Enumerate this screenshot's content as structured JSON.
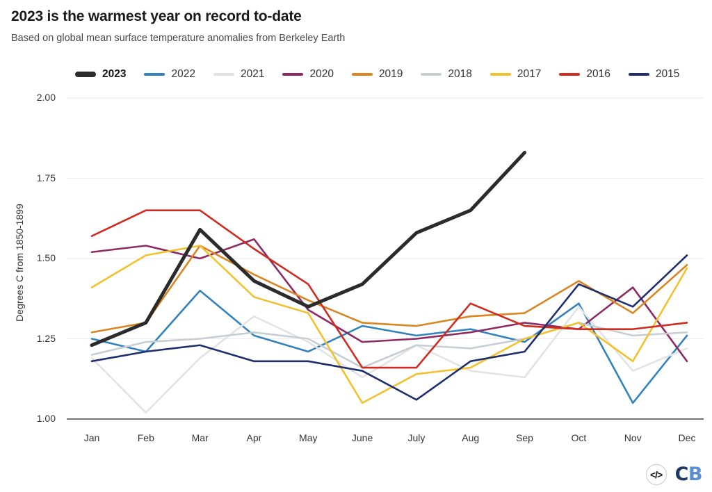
{
  "header": {
    "title": "2023 is the warmest year on record to-date",
    "subtitle": "Based on global mean surface temperature anomalies from Berkeley Earth"
  },
  "footer": {
    "code_icon_glyph": "</>",
    "logo_c": "CB",
    "logo_c_part": "C",
    "logo_b_part": "B"
  },
  "legend": {
    "position": "top",
    "entries": [
      {
        "label": "2023",
        "color": "#2b2b2b",
        "bold": true
      },
      {
        "label": "2022",
        "color": "#3182bd",
        "bold": false
      },
      {
        "label": "2021",
        "color": "#e3e3e3",
        "bold": false
      },
      {
        "label": "2020",
        "color": "#8e2a63",
        "bold": false
      },
      {
        "label": "2019",
        "color": "#d98521",
        "bold": false
      },
      {
        "label": "2018",
        "color": "#c6cdd3",
        "bold": false
      },
      {
        "label": "2017",
        "color": "#f2c12e",
        "bold": false
      },
      {
        "label": "2016",
        "color": "#cf2b20",
        "bold": false
      },
      {
        "label": "2015",
        "color": "#1f2f6e",
        "bold": false
      }
    ]
  },
  "chart_data": {
    "type": "line",
    "title": "2023 is the warmest year on record to-date",
    "subtitle": "Based on global mean surface temperature anomalies from Berkeley Earth",
    "xlabel": "",
    "ylabel": "Degrees C from 1850-1899",
    "categories": [
      "Jan",
      "Feb",
      "Mar",
      "Apr",
      "May",
      "June",
      "July",
      "Aug",
      "Sep",
      "Oct",
      "Nov",
      "Dec"
    ],
    "ylim": [
      1.0,
      2.0
    ],
    "yticks": [
      1.0,
      1.25,
      1.5,
      1.75,
      2.0
    ],
    "ytick_labels": [
      "1.00",
      "1.25",
      "1.50",
      "1.75",
      "2.00"
    ],
    "grid": true,
    "legend_position": "top",
    "series": [
      {
        "name": "2023",
        "color": "#2b2b2b",
        "width": 5.0,
        "values": [
          1.23,
          1.3,
          1.59,
          1.43,
          1.35,
          1.42,
          1.58,
          1.65,
          1.83,
          null,
          null,
          null
        ]
      },
      {
        "name": "2022",
        "color": "#3182bd",
        "width": 2.6,
        "values": [
          1.25,
          1.21,
          1.4,
          1.26,
          1.21,
          1.29,
          1.26,
          1.28,
          1.24,
          1.36,
          1.05,
          1.26
        ]
      },
      {
        "name": "2021",
        "color": "#e3e3e3",
        "width": 2.6,
        "values": [
          1.19,
          1.02,
          1.19,
          1.32,
          1.24,
          1.13,
          1.23,
          1.15,
          1.13,
          1.35,
          1.15,
          1.22
        ]
      },
      {
        "name": "2020",
        "color": "#8e2a63",
        "width": 2.6,
        "values": [
          1.52,
          1.54,
          1.5,
          1.56,
          1.34,
          1.24,
          1.25,
          1.27,
          1.3,
          1.28,
          1.41,
          1.18
        ]
      },
      {
        "name": "2019",
        "color": "#d98521",
        "width": 2.6,
        "values": [
          1.27,
          1.3,
          1.54,
          1.45,
          1.37,
          1.3,
          1.29,
          1.32,
          1.33,
          1.43,
          1.33,
          1.48
        ]
      },
      {
        "name": "2018",
        "color": "#c6cdd3",
        "width": 2.6,
        "values": [
          1.2,
          1.24,
          1.25,
          1.27,
          1.25,
          1.16,
          1.23,
          1.22,
          1.25,
          1.3,
          1.26,
          1.27
        ]
      },
      {
        "name": "2017",
        "color": "#f2c12e",
        "width": 2.6,
        "values": [
          1.41,
          1.51,
          1.54,
          1.38,
          1.33,
          1.05,
          1.14,
          1.16,
          1.25,
          1.3,
          1.18,
          1.47
        ]
      },
      {
        "name": "2016",
        "color": "#cf2b20",
        "width": 2.6,
        "values": [
          1.57,
          1.65,
          1.65,
          1.53,
          1.42,
          1.16,
          1.16,
          1.36,
          1.29,
          1.28,
          1.28,
          1.3
        ]
      },
      {
        "name": "2015",
        "color": "#1f2f6e",
        "width": 2.6,
        "values": [
          1.18,
          1.21,
          1.23,
          1.18,
          1.18,
          1.15,
          1.06,
          1.18,
          1.21,
          1.42,
          1.35,
          1.51
        ]
      }
    ]
  },
  "axes": {
    "x_tick_labels": [
      "Jan",
      "Feb",
      "Mar",
      "Apr",
      "May",
      "June",
      "July",
      "Aug",
      "Sep",
      "Oct",
      "Nov",
      "Dec"
    ],
    "y_tick_labels": [
      "2.00",
      "1.75",
      "1.50",
      "1.25",
      "1.00"
    ],
    "y_axis_title": "Degrees C from 1850-1899"
  }
}
